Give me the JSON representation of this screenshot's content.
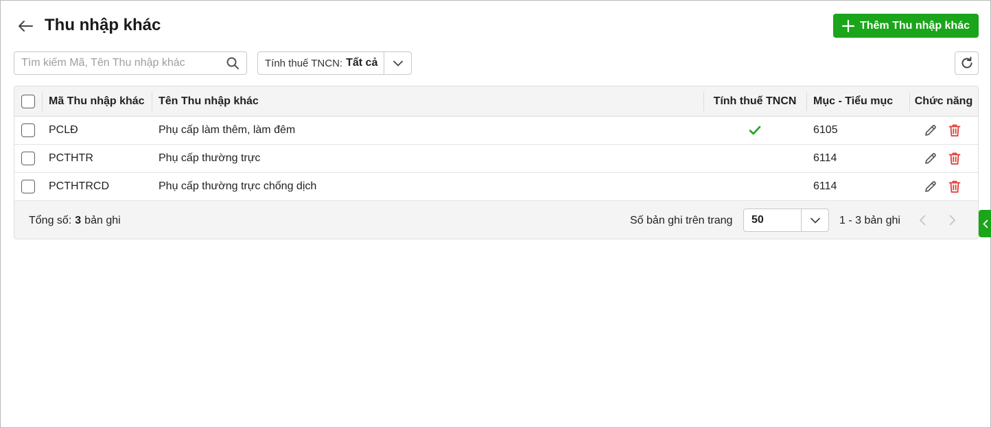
{
  "header": {
    "title": "Thu nhập khác",
    "add_button_label": "Thêm Thu nhập khác"
  },
  "toolbar": {
    "search_placeholder": "Tìm kiếm Mã, Tên Thu nhập khác",
    "search_value": "",
    "filter_label": "Tính thuế TNCN:",
    "filter_value": "Tất cả"
  },
  "table": {
    "columns": {
      "code": "Mã Thu nhập khác",
      "name": "Tên Thu nhập khác",
      "taxable": "Tính thuế TNCN",
      "category": "Mục - Tiểu mục",
      "actions": "Chức năng"
    },
    "rows": [
      {
        "code": "PCLĐ",
        "name": "Phụ cấp làm thêm, làm đêm",
        "taxable": true,
        "category": "6105"
      },
      {
        "code": "PCTHTR",
        "name": "Phụ cấp thường trực",
        "taxable": false,
        "category": "6114"
      },
      {
        "code": "PCTHTRCD",
        "name": "Phụ cấp thường trực chống dịch",
        "taxable": false,
        "category": "6114"
      }
    ]
  },
  "footer": {
    "total_prefix": "Tổng số:",
    "total_count": "3",
    "total_suffix": "bản ghi",
    "page_size_label": "Số bản ghi trên trang",
    "page_size_value": "50",
    "range_text": "1 - 3 bản ghi"
  },
  "icons": {
    "back": "arrow-left-icon",
    "add": "plus-icon",
    "search": "search-icon",
    "dropdown": "chevron-down-icon",
    "refresh": "refresh-icon",
    "check": "check-icon",
    "edit": "pencil-icon",
    "delete": "trash-icon",
    "prev": "chevron-left-icon",
    "next": "chevron-right-icon",
    "side": "chevron-left-icon"
  },
  "colors": {
    "primary": "#1aa51a",
    "delete": "#e53935",
    "check": "#1aa51a"
  }
}
